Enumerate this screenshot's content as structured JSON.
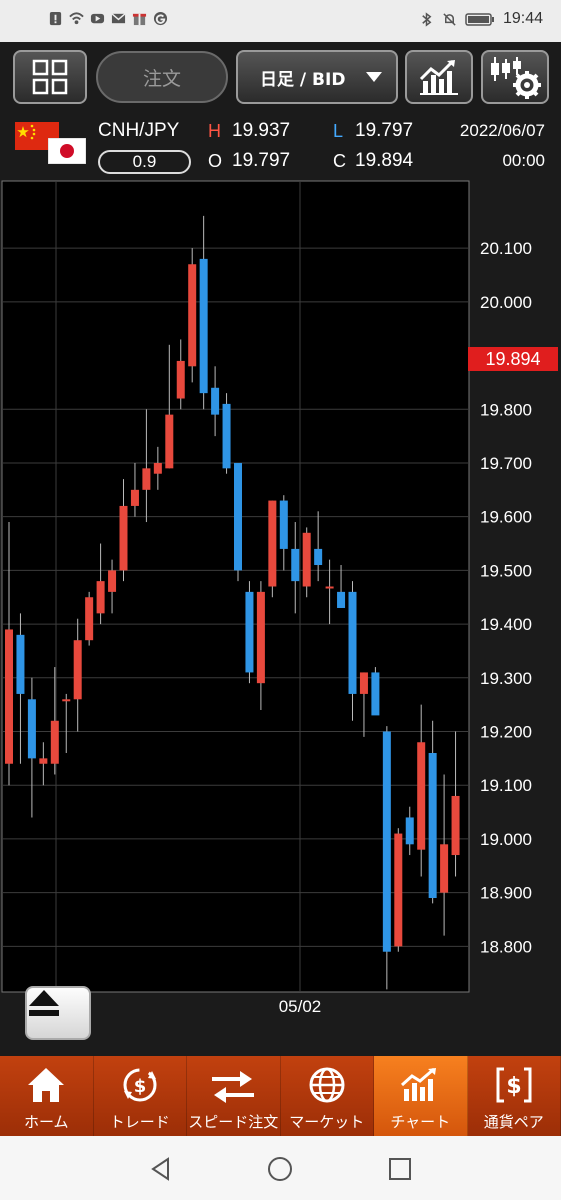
{
  "status_bar": {
    "time": "19:44"
  },
  "toolbar": {
    "order_label": "注文",
    "timeframe_label": "日足 / BID"
  },
  "quote": {
    "symbol": "CNH/JPY",
    "spread": "0.9",
    "h_label": "H",
    "h_value": "19.937",
    "l_label": "L",
    "l_value": "19.797",
    "o_label": "O",
    "o_value": "19.797",
    "c_label": "C",
    "c_value": "19.894",
    "date": "2022/06/07",
    "time": "00:00"
  },
  "colors": {
    "up": "#e8493d",
    "down": "#2f95e6",
    "accent": "#f47a1f",
    "price_tag": "#e01e1e",
    "high_label": "#ff5544",
    "low_label": "#44aaff"
  },
  "chart_data": {
    "type": "candlestick",
    "y_ticks": [
      "20.100",
      "20.000",
      "19.800",
      "19.700",
      "19.600",
      "19.500",
      "19.400",
      "19.300",
      "19.200",
      "19.100",
      "19.000",
      "18.900",
      "18.800"
    ],
    "y_tick_values": [
      20.1,
      20.0,
      19.8,
      19.7,
      19.6,
      19.5,
      19.4,
      19.3,
      19.2,
      19.1,
      19.0,
      18.9,
      18.8
    ],
    "ylim": [
      18.715,
      20.225
    ],
    "x_label": "05/02",
    "current_price": "19.894",
    "current_price_value": 19.894,
    "grid": true,
    "candles": [
      {
        "o": 19.14,
        "h": 19.59,
        "l": 19.1,
        "c": 19.39
      },
      {
        "o": 19.38,
        "h": 19.42,
        "l": 19.14,
        "c": 19.27
      },
      {
        "o": 19.26,
        "h": 19.3,
        "l": 19.04,
        "c": 19.15
      },
      {
        "o": 19.14,
        "h": 19.18,
        "l": 19.1,
        "c": 19.15
      },
      {
        "o": 19.14,
        "h": 19.32,
        "l": 19.12,
        "c": 19.22
      },
      {
        "o": 19.26,
        "h": 19.27,
        "l": 19.16,
        "c": 19.26
      },
      {
        "o": 19.26,
        "h": 19.41,
        "l": 19.2,
        "c": 19.37
      },
      {
        "o": 19.37,
        "h": 19.46,
        "l": 19.36,
        "c": 19.45
      },
      {
        "o": 19.42,
        "h": 19.55,
        "l": 19.4,
        "c": 19.48
      },
      {
        "o": 19.46,
        "h": 19.52,
        "l": 19.42,
        "c": 19.5
      },
      {
        "o": 19.5,
        "h": 19.67,
        "l": 19.48,
        "c": 19.62
      },
      {
        "o": 19.62,
        "h": 19.7,
        "l": 19.6,
        "c": 19.65
      },
      {
        "o": 19.65,
        "h": 19.8,
        "l": 19.59,
        "c": 19.69
      },
      {
        "o": 19.68,
        "h": 19.73,
        "l": 19.65,
        "c": 19.7
      },
      {
        "o": 19.69,
        "h": 19.92,
        "l": 19.69,
        "c": 19.79
      },
      {
        "o": 19.82,
        "h": 19.93,
        "l": 19.8,
        "c": 19.89
      },
      {
        "o": 19.88,
        "h": 20.1,
        "l": 19.85,
        "c": 20.07
      },
      {
        "o": 20.08,
        "h": 20.16,
        "l": 19.8,
        "c": 19.83
      },
      {
        "o": 19.84,
        "h": 19.88,
        "l": 19.75,
        "c": 19.79
      },
      {
        "o": 19.81,
        "h": 19.83,
        "l": 19.68,
        "c": 19.69
      },
      {
        "o": 19.7,
        "h": 19.7,
        "l": 19.48,
        "c": 19.5
      },
      {
        "o": 19.46,
        "h": 19.48,
        "l": 19.29,
        "c": 19.31
      },
      {
        "o": 19.29,
        "h": 19.48,
        "l": 19.24,
        "c": 19.46
      },
      {
        "o": 19.47,
        "h": 19.63,
        "l": 19.45,
        "c": 19.63
      },
      {
        "o": 19.63,
        "h": 19.64,
        "l": 19.5,
        "c": 19.54
      },
      {
        "o": 19.54,
        "h": 19.59,
        "l": 19.42,
        "c": 19.48
      },
      {
        "o": 19.47,
        "h": 19.58,
        "l": 19.45,
        "c": 19.57
      },
      {
        "o": 19.54,
        "h": 19.61,
        "l": 19.48,
        "c": 19.51
      },
      {
        "o": 19.47,
        "h": 19.52,
        "l": 19.4,
        "c": 19.47
      },
      {
        "o": 19.46,
        "h": 19.51,
        "l": 19.43,
        "c": 19.43
      },
      {
        "o": 19.46,
        "h": 19.48,
        "l": 19.22,
        "c": 19.27
      },
      {
        "o": 19.27,
        "h": 19.31,
        "l": 19.19,
        "c": 19.31
      },
      {
        "o": 19.31,
        "h": 19.32,
        "l": 19.24,
        "c": 19.23
      },
      {
        "o": 19.2,
        "h": 19.21,
        "l": 18.72,
        "c": 18.79
      },
      {
        "o": 18.8,
        "h": 19.02,
        "l": 18.79,
        "c": 19.01
      },
      {
        "o": 19.04,
        "h": 19.06,
        "l": 18.97,
        "c": 18.99
      },
      {
        "o": 18.98,
        "h": 19.25,
        "l": 18.93,
        "c": 19.18
      },
      {
        "o": 19.16,
        "h": 19.22,
        "l": 18.88,
        "c": 18.89
      },
      {
        "o": 18.9,
        "h": 19.12,
        "l": 18.82,
        "c": 18.99
      },
      {
        "o": 18.97,
        "h": 19.2,
        "l": 18.93,
        "c": 19.08
      }
    ]
  },
  "nav": {
    "items": [
      {
        "label": "ホーム",
        "icon": "home-icon"
      },
      {
        "label": "トレード",
        "icon": "trade-icon"
      },
      {
        "label": "スピード注文",
        "icon": "speed-order-icon"
      },
      {
        "label": "マーケット",
        "icon": "market-icon"
      },
      {
        "label": "チャート",
        "icon": "chart-icon"
      },
      {
        "label": "通貨ペア",
        "icon": "currency-pair-icon"
      }
    ],
    "active": "チャート"
  }
}
